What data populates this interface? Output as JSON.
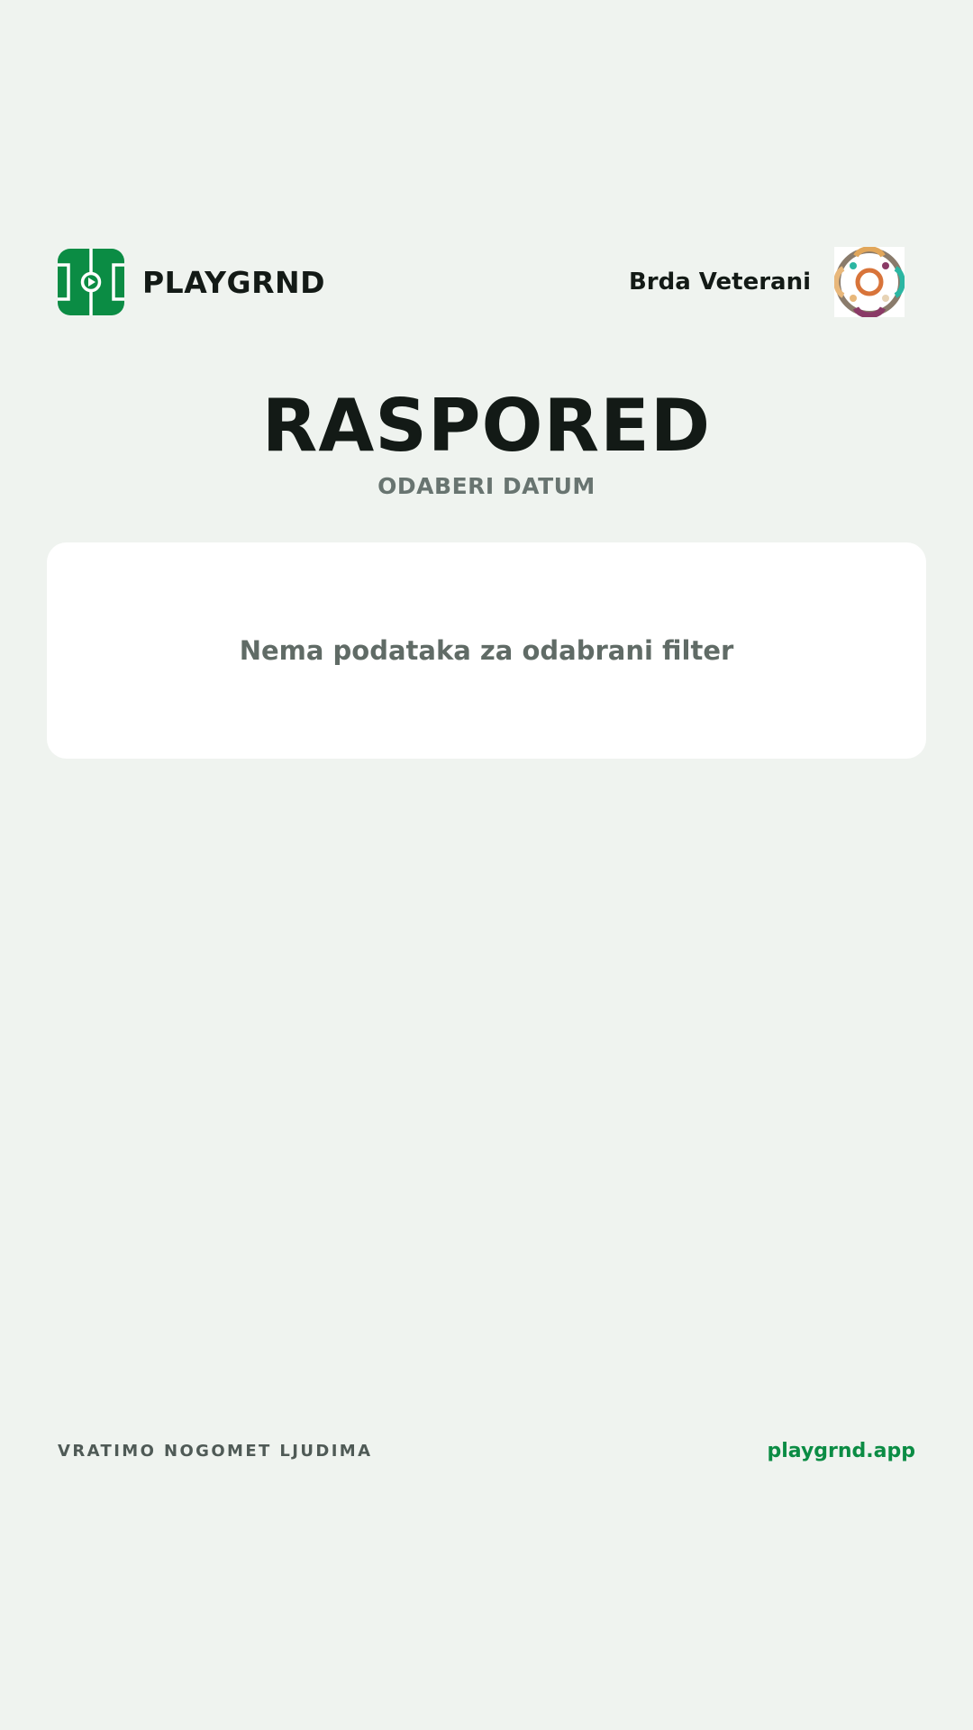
{
  "header": {
    "brand_name": "PLAYGRND",
    "team_name": "Brda Veterani"
  },
  "page": {
    "title": "RASPORED",
    "subtitle": "ODABERI DATUM"
  },
  "schedule": {
    "empty_message": "Nema podataka za odabrani filter"
  },
  "footer": {
    "tagline": "VRATIMO NOGOMET LJUDIMA",
    "site_link": "playgrnd.app"
  },
  "icons": {
    "brand_logo": "football-pitch-icon",
    "team_crest": "team-crest-icon"
  },
  "colors": {
    "background": "#eff3ef",
    "brand_green": "#0b8c44",
    "text_dark": "#131a16",
    "text_muted": "#687470",
    "card": "#ffffff"
  }
}
